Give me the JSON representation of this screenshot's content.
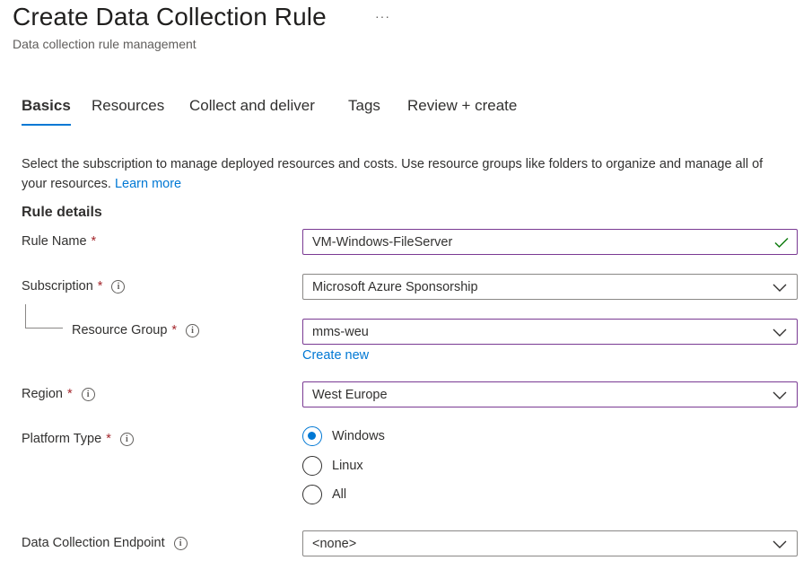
{
  "header": {
    "title": "Create Data Collection Rule",
    "more": "···",
    "subtitle": "Data collection rule management"
  },
  "tabs": [
    {
      "label": "Basics",
      "active": true
    },
    {
      "label": "Resources",
      "active": false
    },
    {
      "label": "Collect and deliver",
      "active": false
    },
    {
      "label": "Tags",
      "active": false
    },
    {
      "label": "Review + create",
      "active": false
    }
  ],
  "description": {
    "text": "Select the subscription to manage deployed resources and costs. Use resource groups like folders to organize and manage all of your resources. ",
    "link": "Learn more"
  },
  "section_title": "Rule details",
  "form": {
    "required_mark": "*",
    "info_glyph": "i",
    "rule_name": {
      "label": "Rule Name",
      "value": "VM-Windows-FileServer",
      "icon": "checkmark-icon"
    },
    "subscription": {
      "label": "Subscription",
      "value": "Microsoft Azure Sponsorship"
    },
    "resource_group": {
      "label": "Resource Group",
      "value": "mms-weu",
      "create_new": "Create new"
    },
    "region": {
      "label": "Region",
      "value": "West Europe"
    },
    "platform_type": {
      "label": "Platform Type",
      "options": [
        "Windows",
        "Linux",
        "All"
      ],
      "selected": "Windows"
    },
    "data_collection_endpoint": {
      "label": "Data Collection Endpoint",
      "value": "<none>"
    }
  },
  "colors": {
    "accent": "#0078d4",
    "required": "#a4262c",
    "focus_border": "#7a3a93",
    "valid_check": "#107c10"
  }
}
